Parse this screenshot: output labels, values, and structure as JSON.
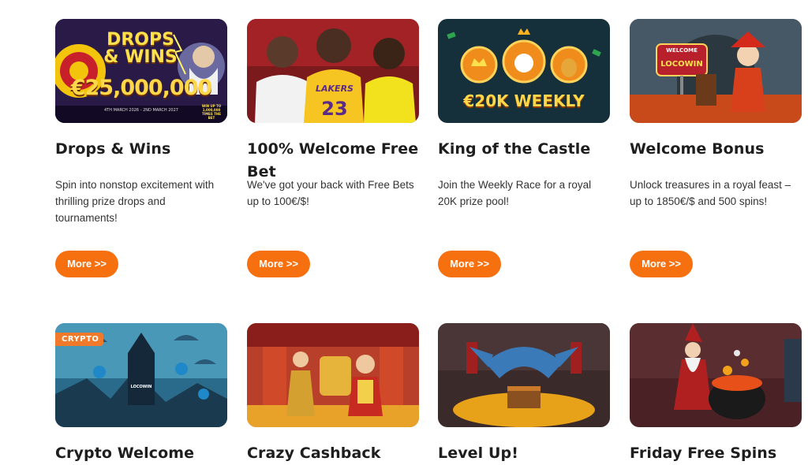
{
  "promotions": [
    {
      "title": "Drops & Wins",
      "description": "Spin into nonstop excitement with thrilling prize drops and tournaments!",
      "button": "More >>",
      "image_text": "DROPS & WINS",
      "image_amount": "€25,000,000",
      "image_date": "4TH MARCH 2026 - 2ND MARCH 2027",
      "image_badge": "WIN UP TO 1,000,000 TIMES THE BET"
    },
    {
      "title": "100% Welcome Free Bet",
      "description": "We've got your back with Free Bets up to 100€/$!",
      "button": "More >>",
      "image_text": "LAKERS",
      "image_jersey": "23"
    },
    {
      "title": "King of the Castle",
      "description": "Join the Weekly Race for a royal 20K prize pool!",
      "button": "More >>",
      "image_text": "€20K WEEKLY"
    },
    {
      "title": "Welcome Bonus",
      "description": "Unlock treasures in a royal feast – up to 1850€/$ and 500 spins!",
      "button": "More >>",
      "image_text": "WELCOME",
      "image_subtext": "LOCOWIN"
    },
    {
      "title": "Crypto Welcome",
      "badge": "CRYPTO",
      "image_text": "LOCOWIN"
    },
    {
      "title": "Crazy Cashback"
    },
    {
      "title": "Level Up!"
    },
    {
      "title": "Friday Free Spins"
    }
  ],
  "colors": {
    "accent": "#f6700f",
    "title": "#1e1e1e",
    "text": "#333333"
  }
}
